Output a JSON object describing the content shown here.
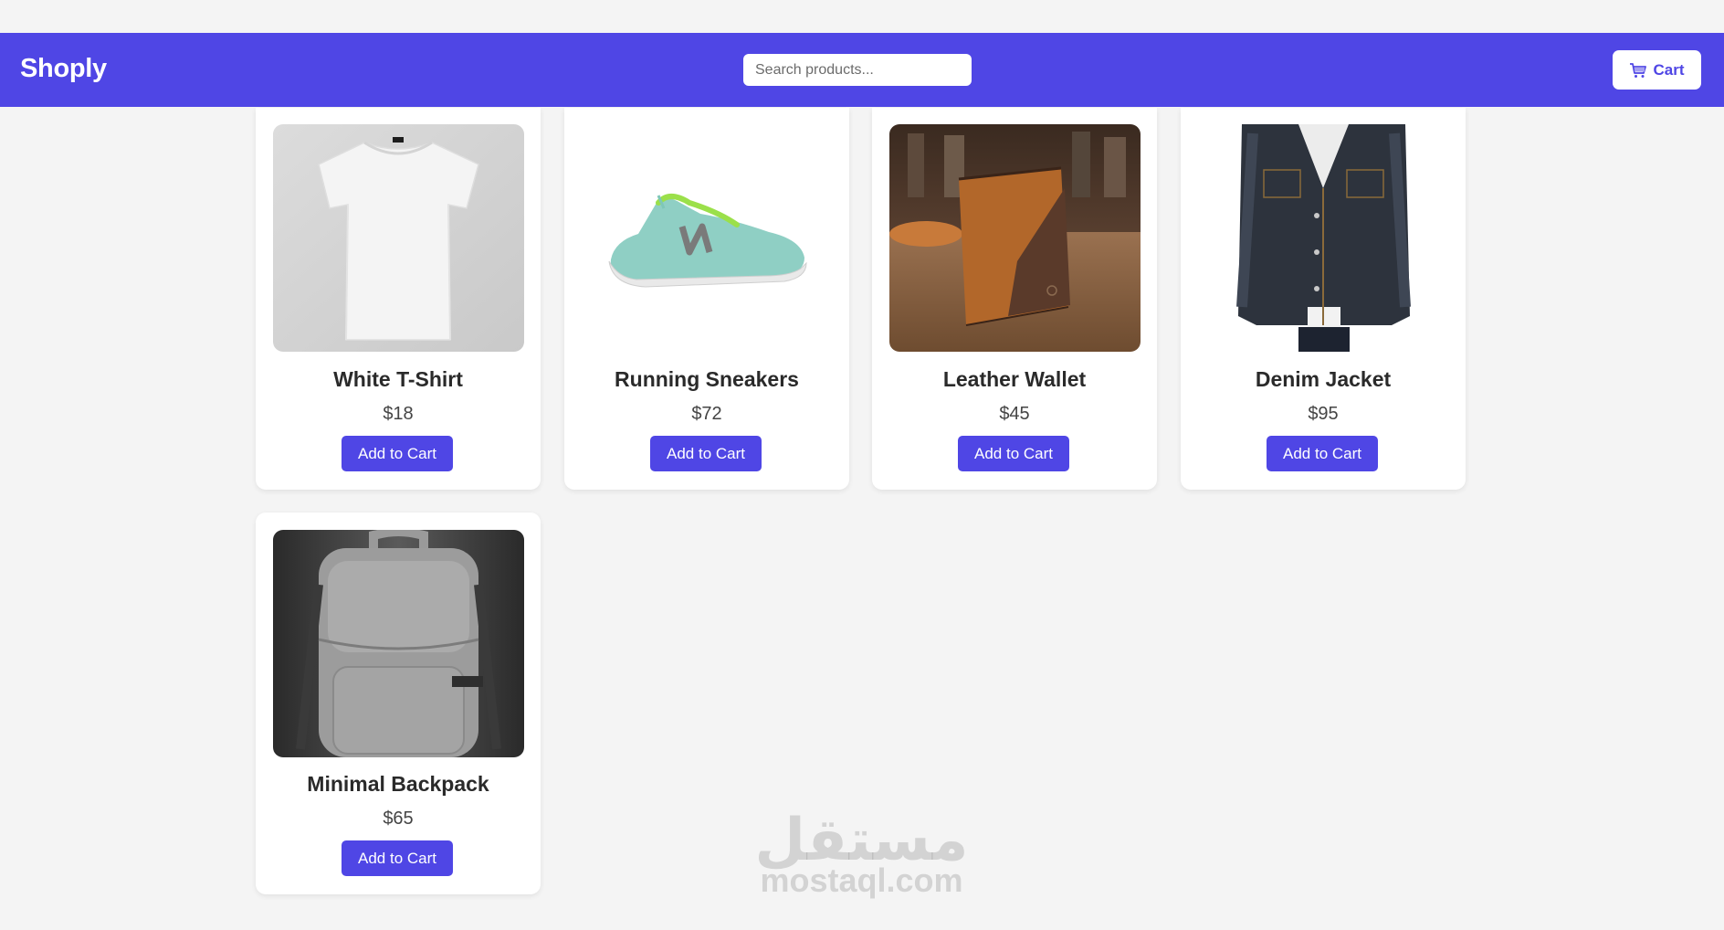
{
  "header": {
    "logo": "Shoply",
    "search_placeholder": "Search products...",
    "cart_label": "Cart",
    "background_color": "#4f46e5"
  },
  "products": [
    {
      "name": "White T-Shirt",
      "price": "$18",
      "button_label": "Add to Cart",
      "image_icon": "tshirt-image"
    },
    {
      "name": "Running Sneakers",
      "price": "$72",
      "button_label": "Add to Cart",
      "image_icon": "sneaker-image"
    },
    {
      "name": "Leather Wallet",
      "price": "$45",
      "button_label": "Add to Cart",
      "image_icon": "wallet-image"
    },
    {
      "name": "Denim Jacket",
      "price": "$95",
      "button_label": "Add to Cart",
      "image_icon": "jacket-image"
    },
    {
      "name": "Minimal Backpack",
      "price": "$65",
      "button_label": "Add to Cart",
      "image_icon": "backpack-image"
    }
  ],
  "watermark": {
    "arabic": "مستقل",
    "latin": "mostaql.com"
  }
}
